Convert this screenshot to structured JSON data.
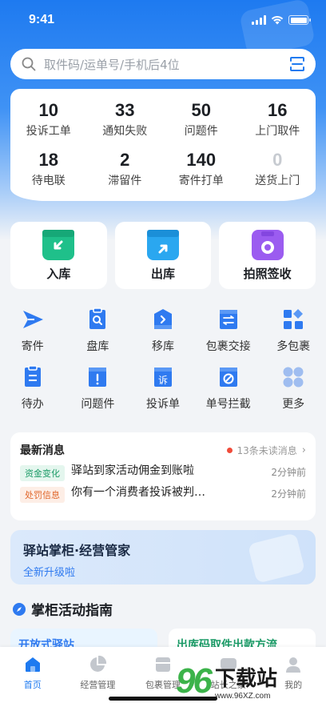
{
  "status_bar": {
    "time": "9:41"
  },
  "search": {
    "placeholder": "取件码/运单号/手机后4位"
  },
  "stats": [
    {
      "value": "10",
      "label": "投诉工单"
    },
    {
      "value": "33",
      "label": "通知失败"
    },
    {
      "value": "50",
      "label": "问题件"
    },
    {
      "value": "16",
      "label": "上门取件"
    },
    {
      "value": "18",
      "label": "待电联"
    },
    {
      "value": "2",
      "label": "滞留件"
    },
    {
      "value": "140",
      "label": "寄件打单"
    },
    {
      "value": "0",
      "label": "送货上门"
    }
  ],
  "big_actions": [
    {
      "label": "入库",
      "icon": "inbound-box-icon",
      "color": "#1fc08a"
    },
    {
      "label": "出库",
      "icon": "outbound-box-icon",
      "color": "#2aa7f0"
    },
    {
      "label": "拍照签收",
      "icon": "camera-icon",
      "color": "#9b5cf0"
    }
  ],
  "menu": [
    {
      "label": "寄件",
      "icon": "send-icon"
    },
    {
      "label": "盘库",
      "icon": "inventory-icon"
    },
    {
      "label": "移库",
      "icon": "move-stock-icon"
    },
    {
      "label": "包裹交接",
      "icon": "handover-icon"
    },
    {
      "label": "多包裹",
      "icon": "multi-package-icon"
    },
    {
      "label": "待办",
      "icon": "todo-icon"
    },
    {
      "label": "问题件",
      "icon": "problem-icon"
    },
    {
      "label": "投诉单",
      "icon": "complaint-icon"
    },
    {
      "label": "单号拦截",
      "icon": "intercept-icon"
    },
    {
      "label": "更多",
      "icon": "more-icon"
    }
  ],
  "news": {
    "title": "最新消息",
    "unread": "13条未读消息",
    "items": [
      {
        "tag": "资金变化",
        "tag_color": "green",
        "text": "驿站到家活动佣金到账啦",
        "time": "2分钟前"
      },
      {
        "tag": "处罚信息",
        "tag_color": "orange",
        "text": "你有一个消费者投诉被判…",
        "time": "2分钟前"
      }
    ]
  },
  "banner": {
    "title": "驿站掌柜·经营管家",
    "subtitle": "全新升级啦"
  },
  "guide": {
    "title": "掌柜活动指南",
    "cards": [
      "开放式驿站",
      "出库码取件出款方流"
    ]
  },
  "tabbar": [
    {
      "label": "首页",
      "icon": "home-icon",
      "active": true
    },
    {
      "label": "经营管理",
      "icon": "pie-chart-icon",
      "active": false
    },
    {
      "label": "包裹管理",
      "icon": "package-icon",
      "active": false
    },
    {
      "label": "站长之家",
      "icon": "chat-icon",
      "active": false
    },
    {
      "label": "我的",
      "icon": "user-icon",
      "active": false
    }
  ],
  "watermark": {
    "logo": "96",
    "name": "下载站",
    "url": "www.96XZ.com"
  },
  "colors": {
    "primary": "#1e7af0",
    "icon_blue": "#2f7af0"
  }
}
